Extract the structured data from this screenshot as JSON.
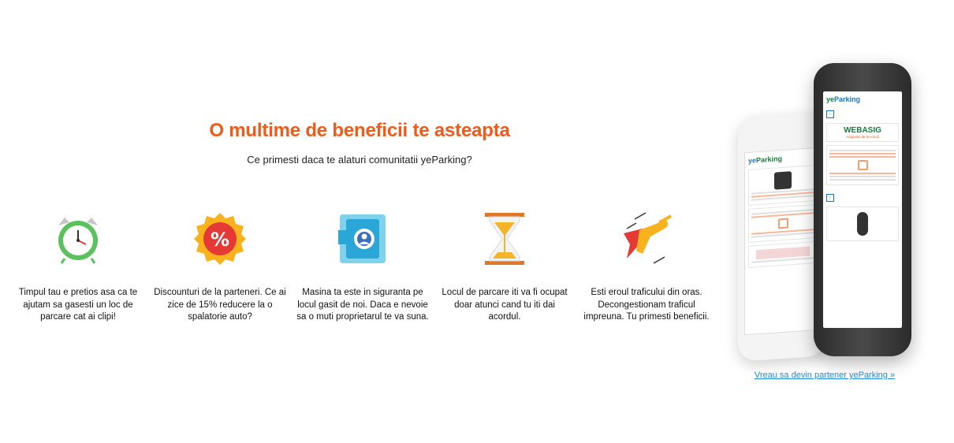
{
  "header": {
    "title": "O multime de beneficii te asteapta",
    "subtitle": "Ce primesti daca te alaturi comunitatii yeParking?"
  },
  "benefits": [
    {
      "icon": "alarm-clock-icon",
      "text": "Timpul tau e pretios asa ca te ajutam sa gasesti un loc de parcare cat ai clipi!"
    },
    {
      "icon": "discount-percent-icon",
      "text": "Discounturi de la parteneri. Ce ai zice de 15% reducere la o spalatorie auto?"
    },
    {
      "icon": "phone-camera-icon",
      "text": "Masina ta este in siguranta pe locul gasit de noi. Daca e nevoie sa o muti proprietarul te va suna."
    },
    {
      "icon": "hourglass-icon",
      "text": "Locul de parcare iti va fi ocupat doar atunci cand tu iti dai acordul."
    },
    {
      "icon": "superhero-icon",
      "text": "Esti eroul traficului din oras. Decongestionam traficul impreuna. Tu primesti beneficii."
    }
  ],
  "phone": {
    "logo_prefix": "ye",
    "logo_suffix": "Parking",
    "brand": "WEBASIG",
    "brand_sub": "Asigurari de la A la Z"
  },
  "cta": {
    "partner_link": "Vreau sa devin partener yeParking »"
  },
  "colors": {
    "accent": "#f05a1a",
    "link": "#1e8bd6",
    "brand_green": "#1a7a3c"
  }
}
